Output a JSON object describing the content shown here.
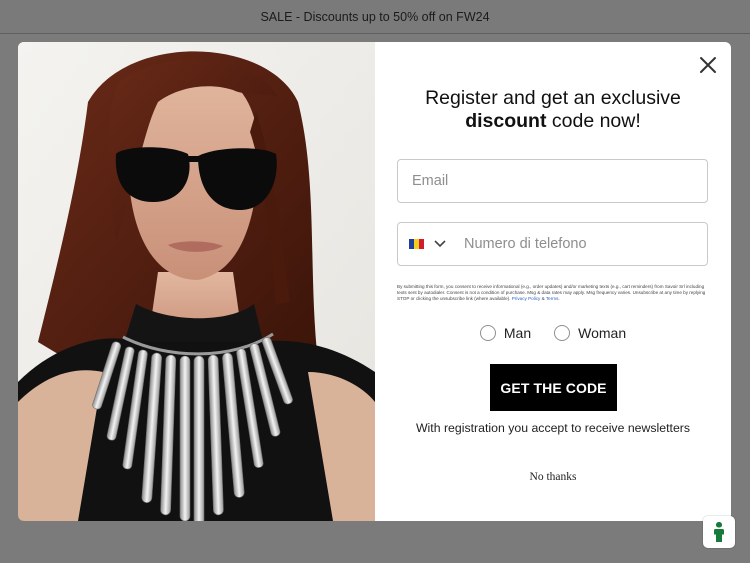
{
  "announcement": "SALE - Discounts up to 50% off on FW24",
  "popup": {
    "headline_line1": "Register and get an exclusive",
    "headline_bold": "discount",
    "headline_rest": " code now!",
    "email_placeholder": "Email",
    "phone_placeholder": "Numero di telefono",
    "country_flag_colors": [
      "#1f3f9e",
      "#f3cd1e",
      "#cf1f2e"
    ],
    "consent_text": "By submitting this form, you consent to receive informational (e.g., order updates) and/or marketing texts (e.g., cart reminders) from Savoir Srl including texts sent by autodialer. Consent is not a condition of purchase. Msg & data rates may apply. Msg frequency varies. Unsubscribe at any time by replying STOP or clicking the unsubscribe link (where available).",
    "privacy_link": "Privacy Policy",
    "consent_amp": " & ",
    "terms_link": "Terms",
    "gender_options": [
      "Man",
      "Woman"
    ],
    "cta_label": "GET THE CODE",
    "note": "With registration you accept to receive newsletters",
    "dismiss_label": "No thanks"
  },
  "icons": {
    "close": "close-icon",
    "chevron": "chevron-down-icon",
    "accessibility": "accessibility-icon"
  },
  "colors": {
    "accessibility_green": "#157a3a",
    "cta_background": "#000000"
  }
}
